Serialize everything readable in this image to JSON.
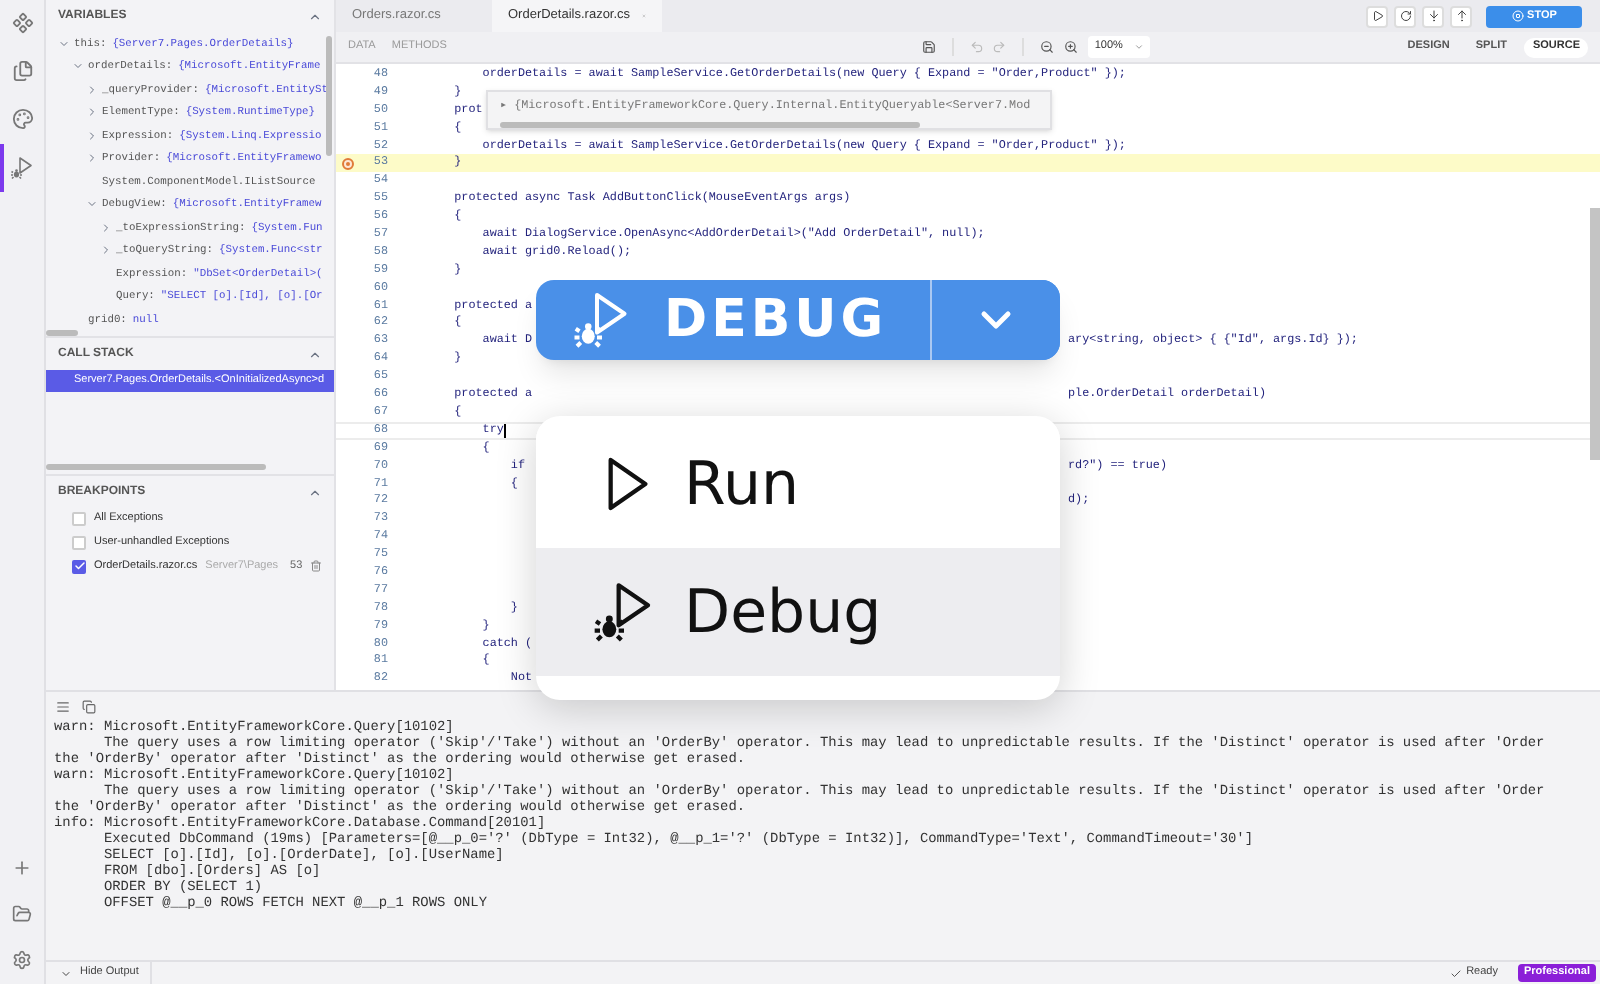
{
  "file_tabs": [
    {
      "label": "Orders.razor.cs",
      "selected": false
    },
    {
      "label": "OrderDetails.razor.cs",
      "selected": true
    }
  ],
  "stop_button": {
    "label": "STOP"
  },
  "panel_tabs": [
    {
      "label": "DATA",
      "selected": false
    },
    {
      "label": "METHODS",
      "selected": false
    }
  ],
  "zoom_select": {
    "value": "100%"
  },
  "view_tabs": [
    {
      "label": "DESIGN",
      "selected": false
    },
    {
      "label": "SPLIT",
      "selected": false
    },
    {
      "label": "SOURCE",
      "selected": true
    }
  ],
  "variables": {
    "title": "VARIABLES",
    "items": [
      {
        "name": "this:",
        "value": "{Server7.Pages.OrderDetails}",
        "expanded": true,
        "children": [
          {
            "name": "orderDetails:",
            "value": "{Microsoft.EntityFrame",
            "expanded": true,
            "children": [
              {
                "name": "_queryProvider:",
                "value": "{Microsoft.EntitySt",
                "expanded": false
              },
              {
                "name": "ElementType:",
                "value": "{System.RuntimeType}",
                "expanded": false
              },
              {
                "name": "Expression:",
                "value": "{System.Linq.Expressio",
                "expanded": false
              },
              {
                "name": "Provider:",
                "value": "{Microsoft.EntityFramewo",
                "expanded": false
              },
              {
                "name": "System.ComponentModel.IListSource"
              },
              {
                "name": "DebugView:",
                "value": "{Microsoft.EntityFramew",
                "expanded": true,
                "children": [
                  {
                    "name": "_toExpressionString:",
                    "value": "{System.Fun",
                    "expanded": false
                  },
                  {
                    "name": "_toQueryString:",
                    "value": "{System.Func<str",
                    "expanded": false
                  },
                  {
                    "name": "Expression:",
                    "value": "\"DbSet<OrderDetail>("
                  },
                  {
                    "name": "Query:",
                    "value": "\"SELECT [o].[Id], [o].[Or"
                  }
                ]
              }
            ]
          },
          {
            "name": "grid0:",
            "value": "null"
          }
        ]
      }
    ]
  },
  "call_stack": {
    "title": "CALL STACK",
    "items": [
      {
        "label": "Server7.Pages.OrderDetails.<OnInitializedAsync>d",
        "selected": true
      }
    ]
  },
  "breakpoints": {
    "title": "BREAKPOINTS",
    "items": [
      {
        "label": "All Exceptions",
        "checked": false
      },
      {
        "label": "User-unhandled Exceptions",
        "checked": false
      },
      {
        "label": "OrderDetails.razor.cs",
        "checked": true,
        "location": "Server7\\Pages",
        "line": "53"
      }
    ]
  },
  "editor": {
    "hover_tip": {
      "text": "▸ {Microsoft.EntityFrameworkCore.Query.Internal.EntityQueryable<Server7.Mod"
    },
    "lines": [
      {
        "n": "48",
        "code": "        orderDetails = await SampleService.GetOrderDetails(new Query { Expand = \"Order,Product\" });",
        "breakpoint": false,
        "active": false,
        "caret": false
      },
      {
        "n": "49",
        "code": "    }",
        "breakpoint": false,
        "active": false,
        "caret": false
      },
      {
        "n": "50",
        "code": "    prot",
        "breakpoint": false,
        "active": false,
        "caret": false
      },
      {
        "n": "51",
        "code": "    {",
        "breakpoint": false,
        "active": false,
        "caret": false
      },
      {
        "n": "52",
        "code": "        orderDetails = await SampleService.GetOrderDetails(new Query { Expand = \"Order,Product\" });",
        "breakpoint": false,
        "active": false,
        "caret": false
      },
      {
        "n": "53",
        "code": "    }",
        "breakpoint": true,
        "active": true,
        "caret": false
      },
      {
        "n": "54",
        "breakpoint": false,
        "active": false,
        "caret": false
      },
      {
        "n": "55",
        "code": "    protected async Task AddButtonClick(MouseEventArgs args)",
        "breakpoint": false,
        "active": false,
        "caret": false
      },
      {
        "n": "56",
        "code": "    {",
        "breakpoint": false,
        "active": false,
        "caret": false
      },
      {
        "n": "57",
        "code": "        await DialogService.OpenAsync<AddOrderDetail>(\"Add OrderDetail\", null);",
        "breakpoint": false,
        "active": false,
        "caret": false
      },
      {
        "n": "58",
        "code": "        await grid0.Reload();",
        "breakpoint": false,
        "active": false,
        "caret": false
      },
      {
        "n": "59",
        "code": "    }",
        "breakpoint": false,
        "active": false,
        "caret": false
      },
      {
        "n": "60",
        "breakpoint": false,
        "active": false,
        "caret": false
      },
      {
        "n": "61",
        "code": "    protected a",
        "breakpoint": false,
        "active": false,
        "caret": false
      },
      {
        "n": "62",
        "code": "    {",
        "breakpoint": false,
        "active": false,
        "caret": false
      },
      {
        "n": "63",
        "code": "        await D",
        "tail": "ary<string, object> { {\"Id\", args.Id} });",
        "breakpoint": false,
        "active": false,
        "caret": false
      },
      {
        "n": "64",
        "code": "    }",
        "breakpoint": false,
        "active": false,
        "caret": false
      },
      {
        "n": "65",
        "breakpoint": false,
        "active": false,
        "caret": false
      },
      {
        "n": "66",
        "code": "    protected a",
        "tail": "ple.OrderDetail orderDetail)",
        "breakpoint": false,
        "active": false,
        "caret": false
      },
      {
        "n": "67",
        "code": "    {",
        "breakpoint": false,
        "active": false,
        "caret": false
      },
      {
        "n": "68",
        "code": "        try",
        "breakpoint": false,
        "active": false,
        "caret": true
      },
      {
        "n": "69",
        "code": "        {",
        "breakpoint": false,
        "active": false,
        "caret": false
      },
      {
        "n": "70",
        "code": "            if",
        "tail": "rd?\") == true)",
        "breakpoint": false,
        "active": false,
        "caret": false
      },
      {
        "n": "71",
        "code": "            {",
        "breakpoint": false,
        "active": false,
        "caret": false
      },
      {
        "n": "72",
        "tail": "d);",
        "breakpoint": false,
        "active": false,
        "caret": false
      },
      {
        "n": "73",
        "breakpoint": false,
        "active": false,
        "caret": false
      },
      {
        "n": "74",
        "breakpoint": false,
        "active": false,
        "caret": false
      },
      {
        "n": "75",
        "breakpoint": false,
        "active": false,
        "caret": false
      },
      {
        "n": "76",
        "breakpoint": false,
        "active": false,
        "caret": false
      },
      {
        "n": "77",
        "breakpoint": false,
        "active": false,
        "caret": false
      },
      {
        "n": "78",
        "code": "            }",
        "breakpoint": false,
        "active": false,
        "caret": false
      },
      {
        "n": "79",
        "code": "        }",
        "breakpoint": false,
        "active": false,
        "caret": false
      },
      {
        "n": "80",
        "code": "        catch (",
        "breakpoint": false,
        "active": false,
        "caret": false
      },
      {
        "n": "81",
        "code": "        {",
        "breakpoint": false,
        "active": false,
        "caret": false
      },
      {
        "n": "82",
        "code": "            Not",
        "breakpoint": false,
        "active": false,
        "caret": false
      }
    ]
  },
  "run_popup": {
    "button": {
      "label": "DEBUG",
      "kind": "debug"
    },
    "menu_open": true,
    "items": [
      {
        "label": "Run",
        "kind": "run",
        "selected": false
      },
      {
        "label": "Debug",
        "kind": "debug",
        "selected": true
      }
    ]
  },
  "output": {
    "lines": [
      "warn: Microsoft.EntityFrameworkCore.Query[10102]",
      "      The query uses a row limiting operator ('Skip'/'Take') without an 'OrderBy' operator. This may lead to unpredictable results. If the 'Distinct' operator is used after 'Order",
      "the 'OrderBy' operator after 'Distinct' as the ordering would otherwise get erased.",
      "warn: Microsoft.EntityFrameworkCore.Query[10102]",
      "      The query uses a row limiting operator ('Skip'/'Take') without an 'OrderBy' operator. This may lead to unpredictable results. If the 'Distinct' operator is used after 'Order",
      "the 'OrderBy' operator after 'Distinct' as the ordering would otherwise get erased.",
      "info: Microsoft.EntityFrameworkCore.Database.Command[20101]",
      "      Executed DbCommand (19ms) [Parameters=[@__p_0='?' (DbType = Int32), @__p_1='?' (DbType = Int32)], CommandType='Text', CommandTimeout='30']",
      "      SELECT [o].[Id], [o].[OrderDate], [o].[UserName]",
      "      FROM [dbo].[Orders] AS [o]",
      "      ORDER BY (SELECT 1)",
      "      OFFSET @__p_0 ROWS FETCH NEXT @__p_1 ROWS ONLY"
    ]
  },
  "status_bar": {
    "toggle": "Hide Output",
    "status": "Ready",
    "badge": "Professional"
  }
}
